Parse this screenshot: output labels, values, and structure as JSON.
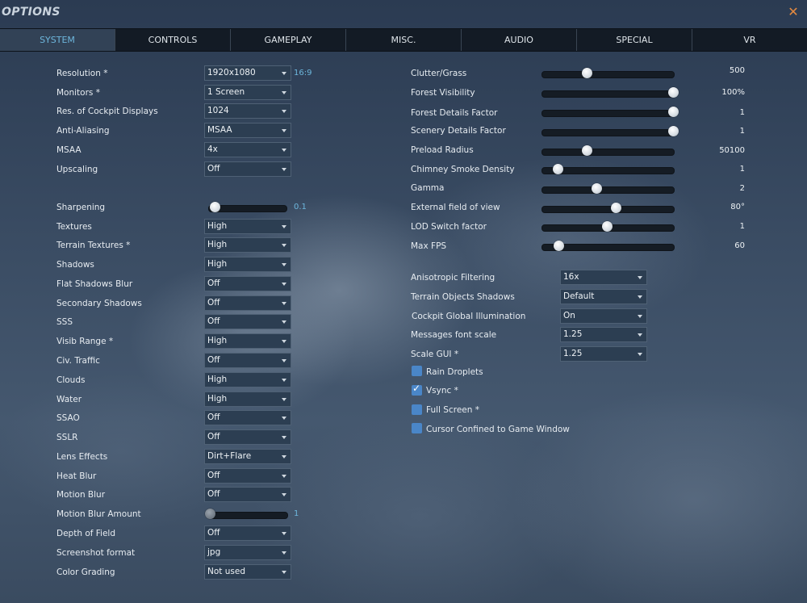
{
  "window": {
    "title": "OPTIONS"
  },
  "tabs": [
    {
      "label": "SYSTEM",
      "active": true
    },
    {
      "label": "CONTROLS"
    },
    {
      "label": "GAMEPLAY"
    },
    {
      "label": "MISC."
    },
    {
      "label": "AUDIO"
    },
    {
      "label": "SPECIAL"
    },
    {
      "label": "VR"
    }
  ],
  "left": {
    "resolution": {
      "label": "Resolution *",
      "value": "1920x1080",
      "hint": "16:9"
    },
    "monitors": {
      "label": "Monitors *",
      "value": "1 Screen"
    },
    "cockpit_displays": {
      "label": "Res. of Cockpit Displays",
      "value": "1024"
    },
    "anti_aliasing": {
      "label": "Anti-Aliasing",
      "value": "MSAA"
    },
    "msaa": {
      "label": "MSAA",
      "value": "4x"
    },
    "upscaling": {
      "label": "Upscaling",
      "value": "Off"
    },
    "sharpening": {
      "label": "Sharpening",
      "value": "0.1",
      "fraction": 0.08
    },
    "textures": {
      "label": "Textures",
      "value": "High"
    },
    "terrain_textures": {
      "label": "Terrain Textures *",
      "value": "High"
    },
    "shadows": {
      "label": "Shadows",
      "value": "High"
    },
    "flat_shadows_blur": {
      "label": "Flat Shadows Blur",
      "value": "Off"
    },
    "secondary_shadows": {
      "label": "Secondary Shadows",
      "value": "Off"
    },
    "sss": {
      "label": "SSS",
      "value": "Off"
    },
    "visib_range": {
      "label": "Visib Range *",
      "value": "High"
    },
    "civ_traffic": {
      "label": "Civ. Traffic",
      "value": "Off"
    },
    "clouds": {
      "label": "Clouds",
      "value": "High"
    },
    "water": {
      "label": "Water",
      "value": "High"
    },
    "ssao": {
      "label": "SSAO",
      "value": "Off"
    },
    "sslr": {
      "label": "SSLR",
      "value": "Off"
    },
    "lens_effects": {
      "label": "Lens Effects",
      "value": "Dirt+Flare"
    },
    "heat_blur": {
      "label": "Heat Blur",
      "value": "Off"
    },
    "motion_blur": {
      "label": "Motion Blur",
      "value": "Off"
    },
    "motion_blur_amount": {
      "label": "Motion Blur Amount",
      "value": "1",
      "fraction": 0.0
    },
    "depth_of_field": {
      "label": "Depth of Field",
      "value": "Off"
    },
    "screenshot_format": {
      "label": "Screenshot format",
      "value": "jpg"
    },
    "color_grading": {
      "label": "Color Grading",
      "value": "Not used"
    }
  },
  "right": {
    "sliders": [
      {
        "label": "Clutter/Grass",
        "value": "500",
        "fraction": 0.34
      },
      {
        "label": "Forest Visibility",
        "value": "100%",
        "fraction": 0.985
      },
      {
        "label": "Forest Details Factor",
        "value": "1",
        "fraction": 0.985
      },
      {
        "label": "Scenery Details Factor",
        "value": "1",
        "fraction": 0.985
      },
      {
        "label": "Preload Radius",
        "value": "50100",
        "fraction": 0.34
      },
      {
        "label": "Chimney Smoke Density",
        "value": "1",
        "fraction": 0.12
      },
      {
        "label": "Gamma",
        "value": "2",
        "fraction": 0.41
      },
      {
        "label": "External field of view",
        "value": "80°",
        "fraction": 0.56
      },
      {
        "label": "LOD Switch factor",
        "value": "1",
        "fraction": 0.49
      },
      {
        "label": "Max FPS",
        "value": "60",
        "fraction": 0.13
      }
    ],
    "anisotropic_filtering": {
      "label": "Anisotropic Filtering",
      "value": "16x"
    },
    "terrain_objects_shadows": {
      "label": "Terrain Objects Shadows",
      "value": "Default"
    },
    "cockpit_global_illumination": {
      "label": "Cockpit Global Illumination",
      "value": "On"
    },
    "messages_font_scale": {
      "label": "Messages font scale",
      "value": "1.25"
    },
    "scale_gui": {
      "label": "Scale GUI *",
      "value": "1.25"
    },
    "checkboxes": [
      {
        "label": "Rain Droplets",
        "checked": false
      },
      {
        "label": "Vsync *",
        "checked": true
      },
      {
        "label": "Full Screen *",
        "checked": false
      },
      {
        "label": "Cursor Confined to Game Window",
        "checked": false
      }
    ]
  }
}
